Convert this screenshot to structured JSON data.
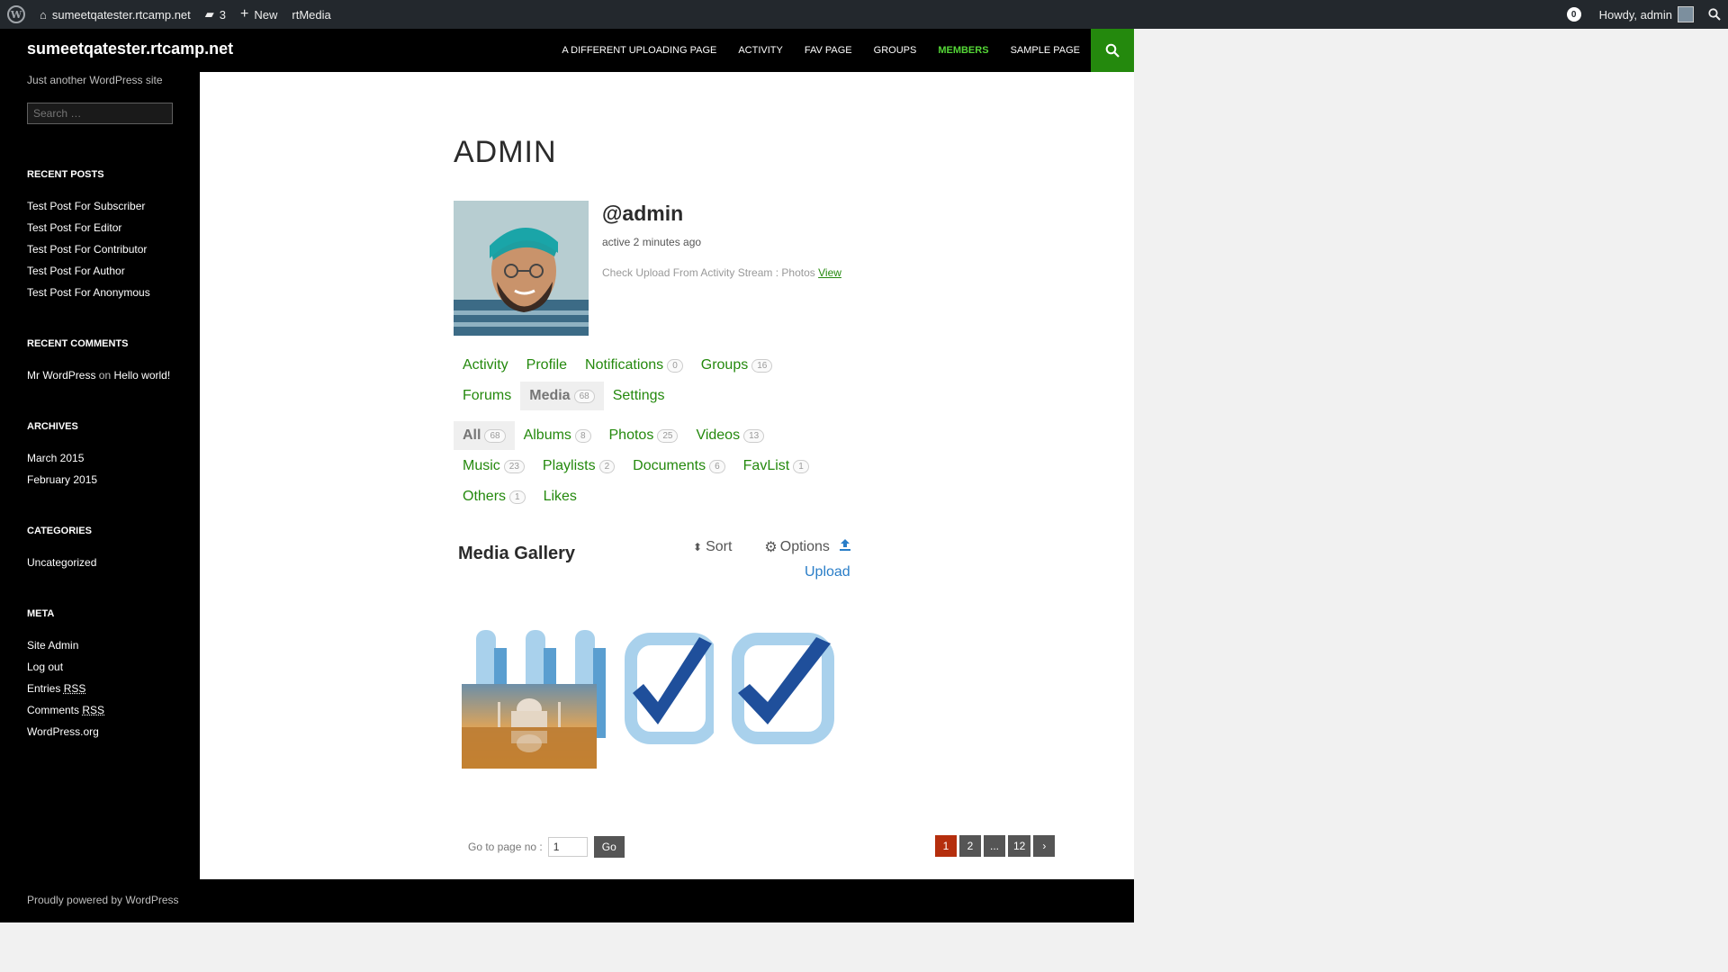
{
  "adminbar": {
    "site_name": "sumeetqatester.rtcamp.net",
    "comments_count": "3",
    "new_label": "New",
    "rtmedia_label": "rtMedia",
    "notif_count": "0",
    "howdy": "Howdy, admin"
  },
  "site": {
    "title": "sumeetqatester.rtcamp.net",
    "description": "Just another WordPress site"
  },
  "nav": [
    "A DIFFERENT UPLOADING PAGE",
    "ACTIVITY",
    "FAV PAGE",
    "GROUPS",
    "MEMBERS",
    "SAMPLE PAGE"
  ],
  "sidebar": {
    "search_placeholder": "Search …",
    "recent_posts_title": "RECENT POSTS",
    "recent_posts": [
      "Test Post For Subscriber",
      "Test Post For Editor",
      "Test Post For Contributor",
      "Test Post For Author",
      "Test Post For Anonymous"
    ],
    "recent_comments_title": "RECENT COMMENTS",
    "comment_author": "Mr WordPress",
    "comment_on": "on",
    "comment_post": "Hello world!",
    "archives_title": "ARCHIVES",
    "archives": [
      "March 2015",
      "February 2015"
    ],
    "categories_title": "CATEGORIES",
    "categories": [
      "Uncategorized"
    ],
    "meta_title": "META",
    "meta_site_admin": "Site Admin",
    "meta_logout": "Log out",
    "meta_entries": "Entries",
    "meta_comments": "Comments",
    "meta_rss": "RSS",
    "meta_wporg": "WordPress.org"
  },
  "profile": {
    "page_title": "ADMIN",
    "handle": "@admin",
    "active": "active 2 minutes ago",
    "activity_text": "Check Upload From Activity Stream : Photos",
    "activity_link": "View"
  },
  "profile_nav": {
    "activity": "Activity",
    "profile": "Profile",
    "notifications": "Notifications",
    "notifications_count": "0",
    "groups": "Groups",
    "groups_count": "16",
    "forums": "Forums",
    "media": "Media",
    "media_count": "68",
    "settings": "Settings"
  },
  "media_nav": {
    "all": "All",
    "all_count": "68",
    "albums": "Albums",
    "albums_count": "8",
    "photos": "Photos",
    "photos_count": "25",
    "videos": "Videos",
    "videos_count": "13",
    "music": "Music",
    "music_count": "23",
    "playlists": "Playlists",
    "playlists_count": "2",
    "documents": "Documents",
    "documents_count": "6",
    "favlist": "FavList",
    "favlist_count": "1",
    "others": "Others",
    "others_count": "1",
    "likes": "Likes"
  },
  "gallery": {
    "title": "Media Gallery",
    "sort": "Sort",
    "options": "Options",
    "upload": "Upload"
  },
  "pagination": {
    "goto_label": "Go to page no :",
    "goto_value": "1",
    "go_button": "Go",
    "pages": [
      "1",
      "2",
      "...",
      "12",
      "›"
    ]
  },
  "footer": {
    "text": "Proudly powered by WordPress"
  },
  "colors": {
    "accent_green": "#24890d",
    "nav_active": "#55d737",
    "pager_active": "#b52e0d",
    "link_blue": "#2a7ec8"
  }
}
